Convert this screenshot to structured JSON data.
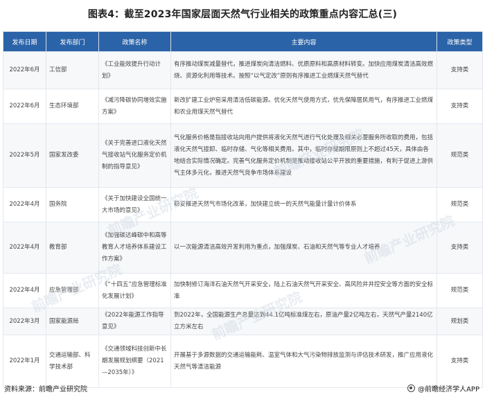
{
  "title": "图表4：截至2023年国家层面天然气行业相关的政策重点内容汇总(三)",
  "table": {
    "headers": [
      "发布日期",
      "发布部门",
      "政策名称",
      "主要内容",
      "政策类型"
    ],
    "rows": [
      {
        "date": "2022年6月",
        "dept": "工信部",
        "name": "《工业能效提升行动计划》",
        "content": "有序推动煤炭减量替代，推进煤炭向清洁燃料、优质原料和高质材料转变。加快应用煤炭清洁高效燃烧、资源化利用等技术。按照“以气定改”原则有序推进工业燃煤天然气替代",
        "type": "支持类"
      },
      {
        "date": "2022年6月",
        "dept": "生态环境部",
        "name": "《减污降碳协同增效实施方案》",
        "content": "新改扩建工业炉窑采用清洁低碳能源。优化天然气使用方式，优先保障居民用气，有序推进工业燃煤和农业用煤天然气替代",
        "type": "支持类"
      },
      {
        "date": "2022年5月",
        "dept": "国家发改委",
        "name": "《关于完善进口液化天然气接收站气化服务定价机制的指导意见》",
        "content": "气化服务价格是指接收站向用户提供将液化天然气进行气化处理及相关必要服务所收取的费用，包括液化天然气接卸、临时存储、气化等相关费用。其中，临时存储期限原则上不超过45天，具体由各地结合实际情况确定。完善气化服务定价机制是推动接收站公平开放的重要措施，有利于促进上游供气主体多元化，推进天然气竞争市场体系建设",
        "type": "规范类"
      },
      {
        "date": "2022年4月",
        "dept": "国务院",
        "name": "《关于加快建设全国统一大市场的意见》",
        "content": "稳妥推进天然气市场化改革，加快建立统一的天然气能量计量计价体系",
        "type": "规范类"
      },
      {
        "date": "2022年4月",
        "dept": "教育部",
        "name": "《加强碳达峰碳中和高等教育人才培养体系建设工作方案》",
        "content": "以一次能源清洁高效开发利用为重点，加强煤炭、石油和天然气等专业人才培养",
        "type": "支持类"
      },
      {
        "date": "2022年4月",
        "dept": "应急管理部",
        "name": "《“十四五”应急管理标准化发展计划》",
        "content": "加快制修订海洋石油天然气开采安全，陆上石油天然气开采安全、高风险井井控安全等方面的安全标准",
        "type": "规范类"
      },
      {
        "date": "2022年3月",
        "dept": "国家能源局",
        "name": "《2022年能源工作指导意见》",
        "content": "到2022年，全国能源生产总量达到44.1亿吨标准煤左右，原油产量2亿吨左右，天然气产量2140亿立方米左右",
        "type": "规划类"
      },
      {
        "date": "2022年1月",
        "dept": "交通运输部、科学技术部",
        "name": "《交通领域科技创新中长期发展规划纲要（2021—2035年）》",
        "content": "开展基于多源数据的交通运输能耗、温室气体和大气污染物排放监测与评估技术研发，推广应用液化天然气等清洁能源",
        "type": "支持类"
      }
    ]
  },
  "footer": {
    "source": "资料来源：前瞻产业研究院",
    "brand": "@前瞻经济学人APP"
  },
  "watermark": "前瞻产业研究院",
  "colors": {
    "header_bg": "#2b63a8",
    "header_text": "#ffffff"
  }
}
